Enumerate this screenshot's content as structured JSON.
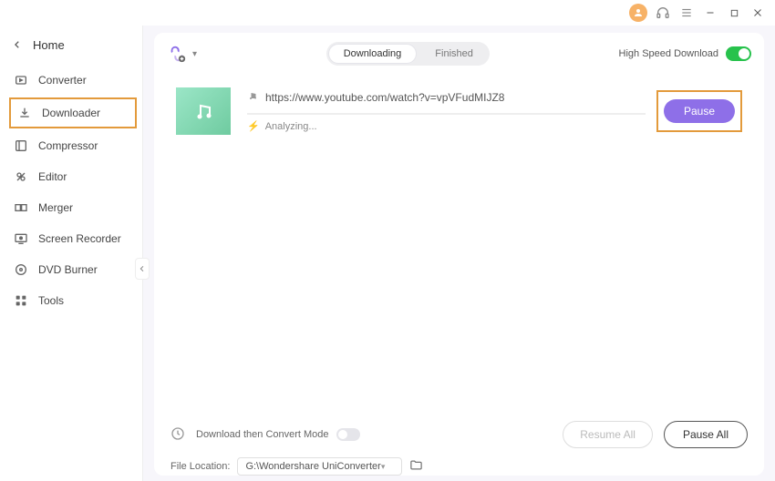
{
  "titlebar": {},
  "home_label": "Home",
  "sidebar": {
    "items": [
      {
        "label": "Converter"
      },
      {
        "label": "Downloader"
      },
      {
        "label": "Compressor"
      },
      {
        "label": "Editor"
      },
      {
        "label": "Merger"
      },
      {
        "label": "Screen Recorder"
      },
      {
        "label": "DVD Burner"
      },
      {
        "label": "Tools"
      }
    ]
  },
  "tabs": {
    "downloading": "Downloading",
    "finished": "Finished"
  },
  "high_speed_label": "High Speed Download",
  "item": {
    "url": "https://www.youtube.com/watch?v=vpVFudMIJZ8",
    "status": "Analyzing...",
    "pause_label": "Pause"
  },
  "footer": {
    "mode_label": "Download then Convert Mode",
    "loc_label": "File Location:",
    "loc_value": "G:\\Wondershare UniConverter",
    "resume_all": "Resume All",
    "pause_all": "Pause All"
  }
}
